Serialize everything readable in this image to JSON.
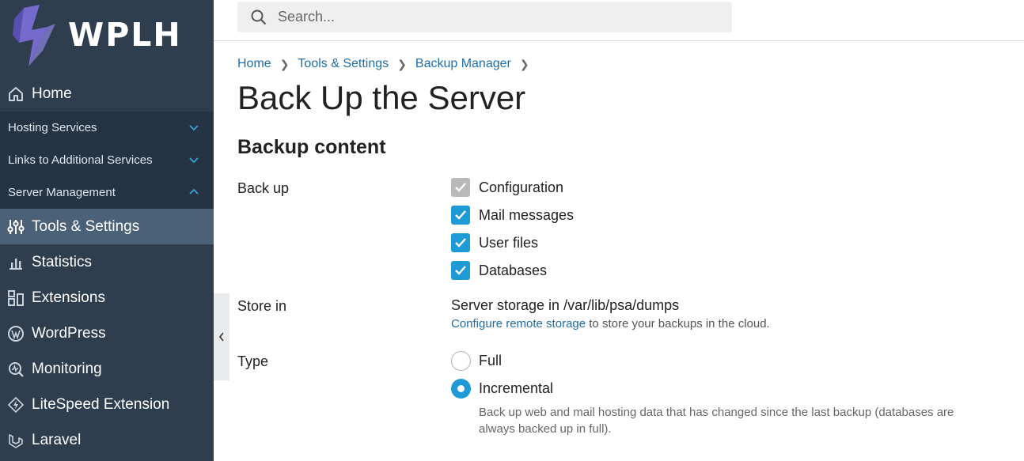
{
  "brand": {
    "name": "WPLH"
  },
  "search": {
    "placeholder": "Search..."
  },
  "sidebar": {
    "home": "Home",
    "groups": [
      {
        "label": "Hosting Services",
        "state": "collapsed"
      },
      {
        "label": "Links to Additional Services",
        "state": "collapsed"
      },
      {
        "label": "Server Management",
        "state": "expanded"
      }
    ],
    "items": [
      {
        "label": "Tools & Settings",
        "icon": "sliders-icon",
        "active": true
      },
      {
        "label": "Statistics",
        "icon": "bar-chart-icon"
      },
      {
        "label": "Extensions",
        "icon": "extensions-icon"
      },
      {
        "label": "WordPress",
        "icon": "wordpress-icon"
      },
      {
        "label": "Monitoring",
        "icon": "monitoring-icon"
      },
      {
        "label": "LiteSpeed Extension",
        "icon": "litespeed-icon"
      },
      {
        "label": "Laravel",
        "icon": "laravel-icon"
      }
    ]
  },
  "breadcrumb": [
    "Home",
    "Tools & Settings",
    "Backup Manager"
  ],
  "page": {
    "title": "Back Up the Server",
    "section": "Backup content"
  },
  "backup": {
    "label": "Back up",
    "options": [
      {
        "label": "Configuration",
        "checked": true,
        "disabled": true
      },
      {
        "label": "Mail messages",
        "checked": true
      },
      {
        "label": "User files",
        "checked": true
      },
      {
        "label": "Databases",
        "checked": true
      }
    ]
  },
  "store": {
    "label": "Store in",
    "value": "Server storage in /var/lib/psa/dumps",
    "link": "Configure remote storage",
    "link_suffix": " to store your backups in the cloud."
  },
  "type": {
    "label": "Type",
    "options": [
      {
        "label": "Full",
        "selected": false
      },
      {
        "label": "Incremental",
        "selected": true
      }
    ],
    "hint": "Back up web and mail hosting data that has changed since the last backup (databases are always backed up in full)."
  },
  "colors": {
    "sidebar": "#2e3e4f",
    "active": "#4b6178",
    "accent": "#1e9ad6",
    "link": "#1d6ea8"
  }
}
